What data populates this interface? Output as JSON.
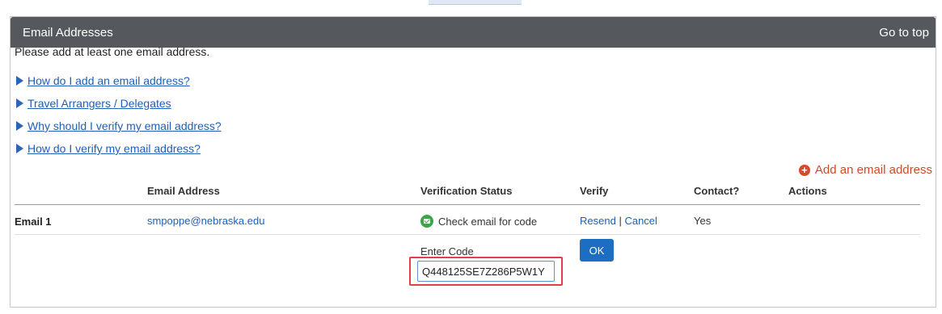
{
  "panel": {
    "title": "Email Addresses",
    "go_to_top": "Go to top"
  },
  "intro_text": "Please add at least one email address.",
  "faq_links": [
    "How do I add an email address?",
    "Travel Arrangers / Delegates",
    "Why should I verify my email address?",
    "How do I verify my email address?"
  ],
  "add_email_label": "Add an email address",
  "table": {
    "headers": {
      "email_address": "Email Address",
      "verification_status": "Verification Status",
      "verify": "Verify",
      "contact": "Contact?",
      "actions": "Actions"
    },
    "rows": [
      {
        "label": "Email 1",
        "email": "smpoppe@nebraska.edu",
        "status": "Check email for code",
        "resend": "Resend",
        "separator": "|",
        "cancel": "Cancel",
        "contact": "Yes"
      }
    ]
  },
  "code_entry": {
    "label": "Enter Code",
    "value": "Q448125SE7Z286P5W1Y",
    "ok_label": "OK"
  },
  "colors": {
    "header_bg": "#55595e",
    "link": "#1e5fb9",
    "add_link": "#d04a2a",
    "status_icon": "#3aa648",
    "ok_button": "#1b6ec2",
    "highlight": "#e0404a"
  }
}
